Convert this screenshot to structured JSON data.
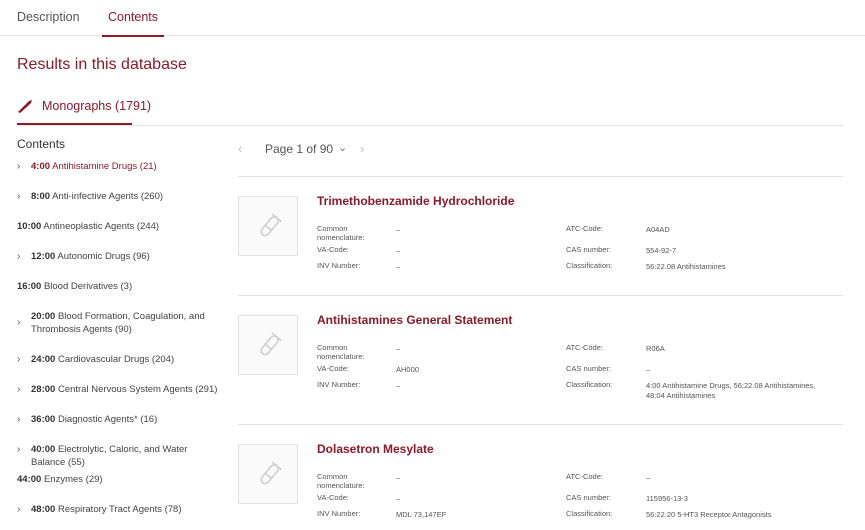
{
  "tabs": [
    "Description",
    "Contents"
  ],
  "results_title": "Results in this database",
  "monographs_tab": {
    "label": "Monographs (1791)",
    "icon": "pipette-icon"
  },
  "contents": {
    "heading": "Contents",
    "items": [
      {
        "num": "4:00",
        "text": " Antihistamine Drugs (21)",
        "chevron": true
      },
      {
        "num": "8:00",
        "text": " Anti-infective Agents (260)",
        "chevron": true
      },
      {
        "num": "10:00",
        "text": " Antineoplastic Agents (244)",
        "chevron": false
      },
      {
        "num": "12:00",
        "text": " Autonomic Drugs (96)",
        "chevron": true
      },
      {
        "num": "16:00",
        "text": " Blood Derivatives (3)",
        "chevron": false
      },
      {
        "num": "20:00",
        "text": " Blood Formation, Coagulation, and Thrombosis Agents (90)",
        "chevron": true
      },
      {
        "num": "24:00",
        "text": " Cardiovascular Drugs (204)",
        "chevron": true
      },
      {
        "num": "28:00",
        "text": " Central Nervous System Agents (291)",
        "chevron": true
      },
      {
        "num": "36:00",
        "text": " Diagnostic Agents* (16)",
        "chevron": true
      },
      {
        "num": "40:00",
        "text": " Electrolytic, Caloric, and Water Balance (55)",
        "chevron": true
      },
      {
        "num": "44:00",
        "text": " Enzymes (29)",
        "chevron": false
      },
      {
        "num": "48:00",
        "text": " Respiratory Tract Agents (78)",
        "chevron": true
      }
    ]
  },
  "pager": {
    "label": "Page 1 of 90",
    "prev": "‹",
    "next": "›",
    "down": "⌄"
  },
  "field_labels": {
    "common": "Common nomenclature:",
    "va": "VA-Code:",
    "inv": "INV Number:",
    "atc": "ATC-Code:",
    "cas": "CAS number:",
    "classification": "Classification:"
  },
  "results": [
    {
      "title": "Trimethobenzamide Hydrochloride",
      "common": "–",
      "va": "–",
      "inv": "–",
      "atc": "A04AD",
      "cas": "554-92-7",
      "classification": "56:22.08 Antihistamines"
    },
    {
      "title": "Antihistamines General Statement",
      "common": "–",
      "va": "AH000",
      "inv": "–",
      "atc": "R06A",
      "cas": "–",
      "classification": "4:00 Antihistamine Drugs, 56:22.08 Antihistamines, 48:04 Antihistamines"
    },
    {
      "title": "Dolasetron Mesylate",
      "common": "–",
      "va": "–",
      "inv": "MDL 73,147EF",
      "atc": "–",
      "cas": "115956-13-3",
      "classification": "56:22.20 5-HT3 Receptor Antagonists"
    }
  ],
  "colors": {
    "accent": "#8b1a2b",
    "divider": "#e3e3e3",
    "text": "#333333"
  }
}
